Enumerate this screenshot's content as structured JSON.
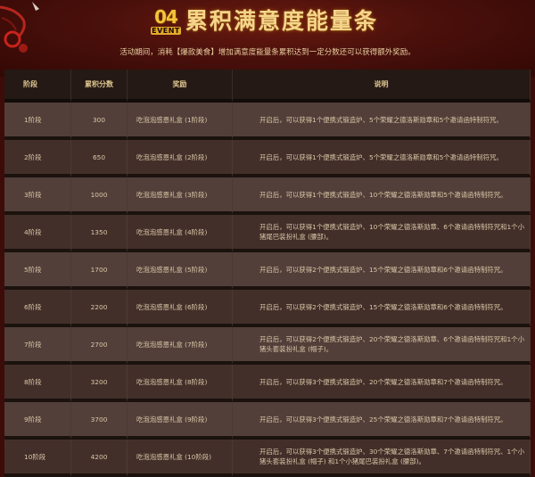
{
  "header": {
    "badge_number": "04",
    "badge_label": "EVENT",
    "title": "累积满意度能量条",
    "description": "活动期间，消耗【爆款美食】增加满意度能量条累积达到一定分数还可以获得额外奖励。"
  },
  "table": {
    "columns": [
      "阶段",
      "累积分数",
      "奖励",
      "说明"
    ],
    "rows": [
      {
        "stage": "1阶段",
        "score": "300",
        "reward": "吃泡泡感恩礼盒 (1阶段)",
        "note": "开启后，可以获得1个便携式锻造炉、5个荣耀之德洛斯勋章和5个邀请函特制符咒。"
      },
      {
        "stage": "2阶段",
        "score": "650",
        "reward": "吃泡泡感恩礼盒 (2阶段)",
        "note": "开启后，可以获得1个便携式锻造炉、5个荣耀之德洛斯勋章和5个邀请函特制符咒。"
      },
      {
        "stage": "3阶段",
        "score": "1000",
        "reward": "吃泡泡感恩礼盒 (3阶段)",
        "note": "开启后，可以获得1个便携式锻造炉、10个荣耀之德洛斯勋章和5个邀请函特制符咒。"
      },
      {
        "stage": "4阶段",
        "score": "1350",
        "reward": "吃泡泡感恩礼盒 (4阶段)",
        "note": "开启后，可以获得1个便携式锻造炉、10个荣耀之德洛斯勋章、6个邀请函特制符咒和1个小猪尾巴装扮礼盒 (腰部)。"
      },
      {
        "stage": "5阶段",
        "score": "1700",
        "reward": "吃泡泡感恩礼盒 (5阶段)",
        "note": "开启后，可以获得2个便携式锻造炉、15个荣耀之德洛斯勋章和6个邀请函特制符咒。"
      },
      {
        "stage": "6阶段",
        "score": "2200",
        "reward": "吃泡泡感恩礼盒 (6阶段)",
        "note": "开启后，可以获得2个便携式锻造炉、15个荣耀之德洛斯勋章和6个邀请函特制符咒。"
      },
      {
        "stage": "7阶段",
        "score": "2700",
        "reward": "吃泡泡感恩礼盒 (7阶段)",
        "note": "开启后，可以获得2个便携式锻造炉、20个荣耀之德洛斯勋章、6个邀请函特制符咒和1个小猪头套装扮礼盒 (帽子)。"
      },
      {
        "stage": "8阶段",
        "score": "3200",
        "reward": "吃泡泡感恩礼盒 (8阶段)",
        "note": "开启后，可以获得3个便携式锻造炉、20个荣耀之德洛斯勋章和7个邀请函特制符咒。"
      },
      {
        "stage": "9阶段",
        "score": "3700",
        "reward": "吃泡泡感恩礼盒 (9阶段)",
        "note": "开启后，可以获得3个便携式锻造炉、25个荣耀之德洛斯勋章和7个邀请函特制符咒。"
      },
      {
        "stage": "10阶段",
        "score": "4200",
        "reward": "吃泡泡感恩礼盒 (10阶段)",
        "note": "开启后，可以获得3个便携式锻造炉、30个荣耀之德洛斯勋章、7个邀请函特制符咒、1个小猪头套装扮礼盒 (帽子) 和1个小猪尾巴装扮礼盒 (腰部)。"
      }
    ]
  },
  "colors": {
    "background": "#3d0c08",
    "title": "#f5d58a",
    "header_row": "#241914",
    "row_light": "#523f39",
    "row_dark": "#432f29"
  }
}
